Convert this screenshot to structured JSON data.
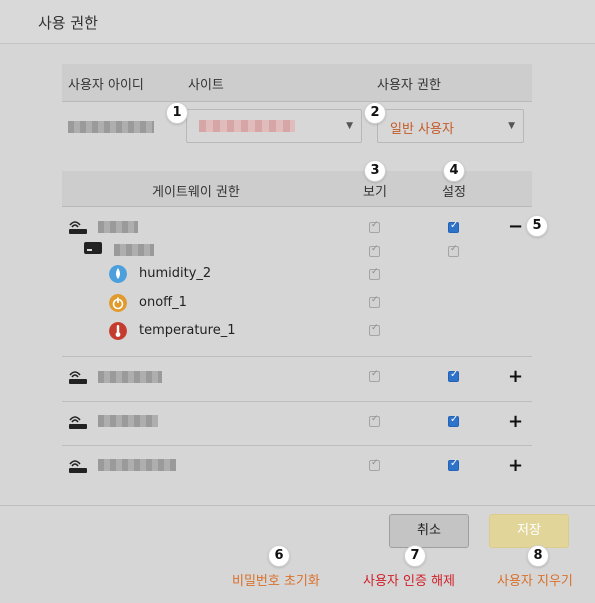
{
  "dialog": {
    "title": "사용 권한"
  },
  "user_table": {
    "headers": {
      "user_id": "사용자 아이디",
      "site": "사이트",
      "role": "사용자 권한"
    },
    "role_value": "일반 사용자"
  },
  "gateway_table": {
    "headers": {
      "gateway_permission": "게이트웨이 권한",
      "view": "보기",
      "settings": "설정"
    },
    "sensors": [
      {
        "label": "humidity_2",
        "icon": "droplet-icon",
        "color": "#4a9fdc"
      },
      {
        "label": "onoff_1",
        "icon": "power-icon",
        "color": "#e29a2d"
      },
      {
        "label": "temperature_1",
        "icon": "thermometer-icon",
        "color": "#c53c2e"
      }
    ],
    "collapse_symbol": "−",
    "expand_symbol": "+"
  },
  "badges": [
    "1",
    "2",
    "3",
    "4",
    "5",
    "6",
    "7",
    "8"
  ],
  "footer": {
    "cancel_label": "취소",
    "save_label": "저장",
    "reset_password_label": "비밀번호 초기화",
    "revoke_auth_label": "사용자 인증 해제",
    "delete_user_label": "사용자 지우기"
  },
  "colors": {
    "accent_orange": "#d9702b",
    "link_red": "#d0202a",
    "checkbox_blue": "#2f72c9",
    "save_disabled": "#e2d599"
  }
}
